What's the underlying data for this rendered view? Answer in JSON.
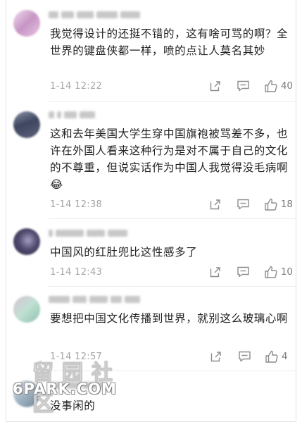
{
  "comments": [
    {
      "text": "我觉得设计的还挺不错的，这有啥可骂的啊？全世界的键盘侠都一样，喷的点让人莫名其妙",
      "time": "1-14 12:22",
      "likes": "40",
      "avatar_colors": [
        "#e7c6e3",
        "#c795c4",
        "#f1dcee"
      ]
    },
    {
      "text": "这和去年美国大学生穿中国旗袍被骂差不多，也许在外国人看来这种行为是对不属于自己的文化的不尊重，但说实话作为中国人我觉得没毛病啊😂",
      "time": "1-14 12:38",
      "likes": "18",
      "avatar_colors": [
        "#3f4660",
        "#8a93a8",
        "#5d6178"
      ]
    },
    {
      "text": "中国风的红肚兜比这性感多了",
      "time": "1-14 12:43",
      "likes": "10",
      "avatar_colors": [
        "#4f4a6e",
        "#a39fc2",
        "#2f2c47"
      ]
    },
    {
      "text": "要想把中国文化传播到世界，就别这么玻璃心啊",
      "time": "1-14 12:57",
      "likes": "4",
      "avatar_colors": [
        "#bfe0d2",
        "#d9c3d6",
        "#8fbfae"
      ]
    },
    {
      "text": "没事闲的",
      "time": "",
      "likes": "",
      "avatar_colors": [
        "#9fb2c0",
        "#d6dde3",
        "#6f8597"
      ]
    }
  ],
  "watermark": {
    "cn": "留园社区",
    "en": "6PARK.COM"
  },
  "colors": {
    "text": "#222222",
    "meta": "#a5a5a5",
    "icon": "#8c8c8c"
  },
  "icons": {
    "share": "share-icon",
    "comment": "comment-icon",
    "like": "thumbs-up-icon"
  }
}
